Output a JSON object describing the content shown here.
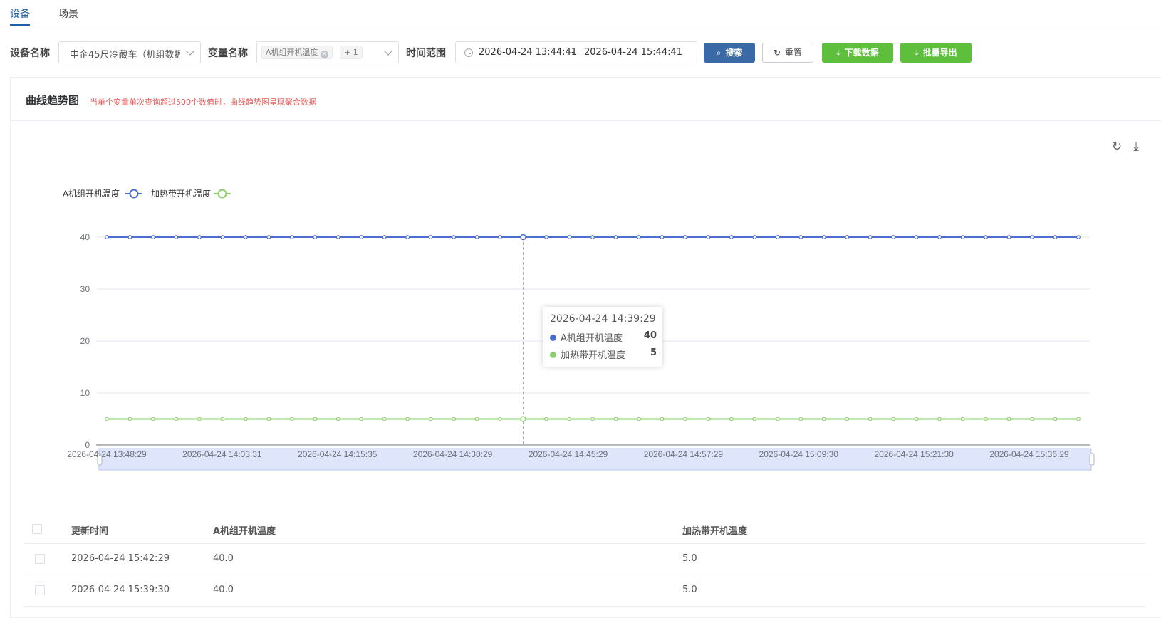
{
  "tabs": [
    {
      "label": "设备"
    },
    {
      "label": "场景"
    }
  ],
  "filters": {
    "device_label": "设备名称",
    "device_value": "中企45尺冷藏车（机组数据",
    "variable_label": "变量名称",
    "variable_tag": "A机组开机温度",
    "variable_more": "+ 1",
    "time_label": "时间范围",
    "time_start": "2026-04-24 13:44:41",
    "time_sep": "-",
    "time_end": "2026-04-24 15:44:41"
  },
  "buttons": {
    "search": "搜索",
    "reset": "重置",
    "download": "下载数据",
    "export": "批量导出"
  },
  "icons": {
    "search": "search-icon",
    "reset": "refresh-icon",
    "download": "download-icon",
    "export": "download-icon",
    "chart_refresh": "refresh-icon",
    "chart_download": "download-icon",
    "clock": "clock-icon"
  },
  "panel": {
    "title": "曲线趋势图",
    "hint": "当单个变量单次查询超过500个数值时，曲线趋势图呈现聚合数据"
  },
  "chart_data": {
    "type": "line",
    "legend_position": "top-left",
    "grid": true,
    "ylim": [
      0,
      40
    ],
    "yticks": [
      0,
      10,
      20,
      30,
      40
    ],
    "x_tick_labels": [
      "2026-04-24 13:48:29",
      "2026-04-24 14:03:31",
      "2026-04-24 14:15:35",
      "2026-04-24 14:30:29",
      "2026-04-24 14:45:29",
      "2026-04-24 14:57:29",
      "2026-04-24 15:09:30",
      "2026-04-24 15:21:30",
      "2026-04-24 15:36:29"
    ],
    "point_count": 43,
    "series": [
      {
        "name": "A机组开机温度",
        "color": "#4a6fd0",
        "values": [
          40,
          40,
          40,
          40,
          40,
          40,
          40,
          40,
          40,
          40,
          40,
          40,
          40,
          40,
          40,
          40,
          40,
          40,
          40,
          40,
          40,
          40,
          40,
          40,
          40,
          40,
          40,
          40,
          40,
          40,
          40,
          40,
          40,
          40,
          40,
          40,
          40,
          40,
          40,
          40,
          40,
          40,
          40
        ]
      },
      {
        "name": "加热带开机温度",
        "color": "#8cd06e",
        "values": [
          5,
          5,
          5,
          5,
          5,
          5,
          5,
          5,
          5,
          5,
          5,
          5,
          5,
          5,
          5,
          5,
          5,
          5,
          5,
          5,
          5,
          5,
          5,
          5,
          5,
          5,
          5,
          5,
          5,
          5,
          5,
          5,
          5,
          5,
          5,
          5,
          5,
          5,
          5,
          5,
          5,
          5,
          5
        ]
      }
    ],
    "highlight_index": 18
  },
  "tooltip": {
    "time": "2026-04-24 14:39:29",
    "rows": [
      {
        "name": "A机组开机温度",
        "value": "40",
        "color": "#4a6fd0"
      },
      {
        "name": "加热带开机温度",
        "value": "5",
        "color": "#8cd06e"
      }
    ]
  },
  "table": {
    "headers": [
      "更新时间",
      "A机组开机温度",
      "加热带开机温度"
    ],
    "rows": [
      [
        "2026-04-24 15:42:29",
        "40.0",
        "5.0"
      ],
      [
        "2026-04-24 15:39:30",
        "40.0",
        "5.0"
      ]
    ]
  }
}
